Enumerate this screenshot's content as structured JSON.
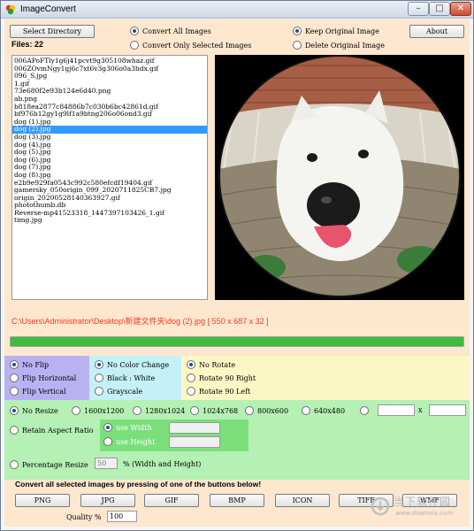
{
  "window": {
    "title": "ImageConvert",
    "controls": {
      "minimize": "–",
      "maximize": "□",
      "close": "✕"
    }
  },
  "toolbar": {
    "select_directory": "Select Directory",
    "files_count": "Files: 22",
    "convert_all": "Convert All Images",
    "convert_selected": "Convert Only Selected Images",
    "keep_original": "Keep Original Image",
    "delete_original": "Delete Original Image",
    "about": "About"
  },
  "files": [
    "006APoFTly1g6j41pcvt9g305108whaz.gif",
    "006ZOvmNgy1gj6c7xt6v3g306o0a3hdx.gif",
    "096_S.jpg",
    "1.gif",
    "73e680f2e93b124e6d40.png",
    "ab.png",
    "b818ea2877c84886b7c030b6bc42861d.gif",
    "bf976b12gy1g9lf1a9btng206o06ond3.gif",
    "dog (1).jpg",
    "dog (2).jpg",
    "dog (3).jpg",
    "dog (4).jpg",
    "dog (5).jpg",
    "dog (6).jpg",
    "dog (7).jpg",
    "dog (8).jpg",
    "e2b9e929fa0543c992c580efcdf19404.gif",
    "gamersky_050origin_099_2020711825CB7.jpg",
    "origin_20200528140363927.gif",
    "photothumb.db",
    "Reverse-mp41523318_1447397103426_1.gif",
    "timg.jpg"
  ],
  "selected_file_index": 9,
  "path_info": "C:\\Users\\Administrator\\Desktop\\新建文件夹\\dog (2).jpg [ 550 x 687 x 32 ]",
  "progress": 1.0,
  "flip": {
    "no_flip": "No Flip",
    "horizontal": "Flip Horizontal",
    "vertical": "Flip Vertical"
  },
  "color": {
    "no_change": "No Color Change",
    "black_white": "Black : White",
    "grayscale": "Grayscale"
  },
  "rotate": {
    "no_rotate": "No Rotate",
    "right": "Rotate 90 Right",
    "left": "Rotate 90 Left"
  },
  "resize": {
    "no_resize": "No Resize",
    "sizes": [
      "1600x1200",
      "1280x1024",
      "1024x768",
      "800x600",
      "640x480"
    ],
    "custom_sep": "x",
    "retain_aspect": "Retain Aspect Ratio",
    "use_width": "use Width",
    "use_height": "use Height",
    "percentage": "Percentage Resize",
    "percentage_value": "50",
    "percentage_suffix": "% (Width and Height)"
  },
  "convert": {
    "instruction": "Convert all selected images by pressing of one of the buttons below!",
    "buttons": [
      "PNG",
      "JPG",
      "GIF",
      "BMP",
      "ICON",
      "TIFF",
      "WMF"
    ],
    "quality_label": "Quality %",
    "quality_value": "100"
  },
  "watermark": {
    "line1": "当下软件园",
    "line2": "www.downxia.com"
  },
  "colors": {
    "background": "#fde7cf",
    "flip_panel": "#b9b2f2",
    "color_panel": "#c4f1f7",
    "rotate_panel": "#fbf7c5",
    "resize_panel": "#b5f0b5",
    "path_text": "#ff3b1f",
    "progress": "#3fbb3f"
  }
}
